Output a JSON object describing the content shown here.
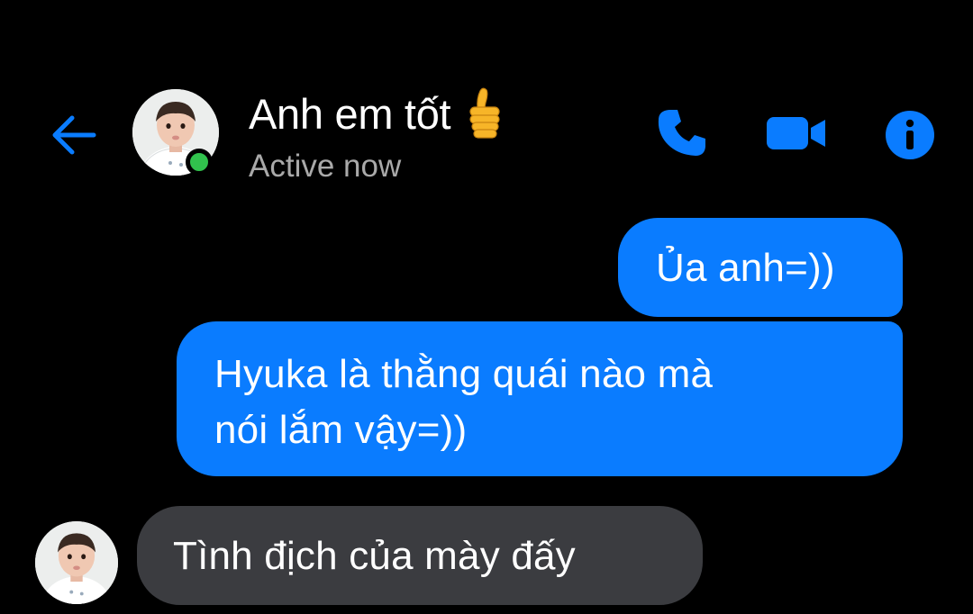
{
  "header": {
    "title": "Anh em tốt",
    "title_emoji": "thumbs-up-emoji",
    "status": "Active now",
    "icons": [
      "back-arrow-icon",
      "phone-icon",
      "video-camera-icon",
      "info-icon"
    ],
    "accent_color": "#0a7cff",
    "online_color": "#31c24d"
  },
  "messages": [
    {
      "direction": "outgoing",
      "text": "Ủa anh=))"
    },
    {
      "direction": "outgoing",
      "lines": [
        "Hyuka là thằng quái nào mà",
        "nói lắm vậy=))"
      ]
    },
    {
      "direction": "incoming",
      "text": "Tình địch của mày đấy"
    }
  ],
  "colors": {
    "background": "#000000",
    "outgoing_bubble": "#0a7cff",
    "incoming_bubble": "#3b3c40",
    "status_text": "#a9a9a9"
  }
}
